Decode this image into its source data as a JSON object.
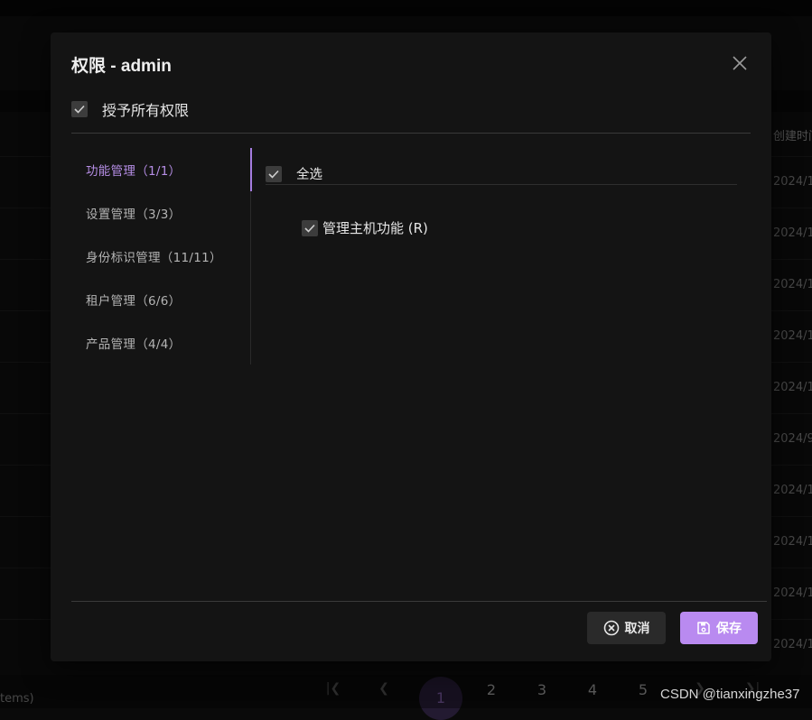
{
  "background": {
    "created_column_header": "创建时间",
    "dates": [
      "2024/1",
      "2024/1",
      "2024/1",
      "2024/1",
      "2024/1",
      "2024/9",
      "2024/1",
      "2024/1",
      "2024/1",
      "2024/1"
    ],
    "footer_items_text": "tems)",
    "pagination": {
      "pages": [
        "1",
        "2",
        "3",
        "4",
        "5"
      ],
      "current": "1"
    }
  },
  "watermark": "CSDN @tianxingzhe37",
  "modal": {
    "title": "权限 - admin",
    "grant_all_label": "授予所有权限",
    "grant_all_checked": true,
    "tabs": [
      {
        "label": "功能管理（1/1）",
        "active": true
      },
      {
        "label": "设置管理（3/3）",
        "active": false
      },
      {
        "label": "身份标识管理（11/11）",
        "active": false
      },
      {
        "label": "租户管理（6/6）",
        "active": false
      },
      {
        "label": "产品管理（4/4）",
        "active": false
      }
    ],
    "select_all_label": "全选",
    "permissions": [
      {
        "label": "管理主机功能 (R)",
        "checked": true
      }
    ],
    "cancel_label": "取消",
    "save_label": "保存"
  },
  "colors": {
    "accent": "#b98af0",
    "accent_text": "#b68ee6",
    "modal_bg": "#141414",
    "checkbox_bg": "#3c3c3c"
  },
  "icons": {
    "close": "close-icon",
    "check": "check-icon",
    "cancel": "circle-x-icon",
    "save": "floppy-disk-icon",
    "first_page": "first-page-icon",
    "prev_page": "chevron-left-icon",
    "next_page": "chevron-right-icon",
    "last_page": "last-page-icon"
  }
}
